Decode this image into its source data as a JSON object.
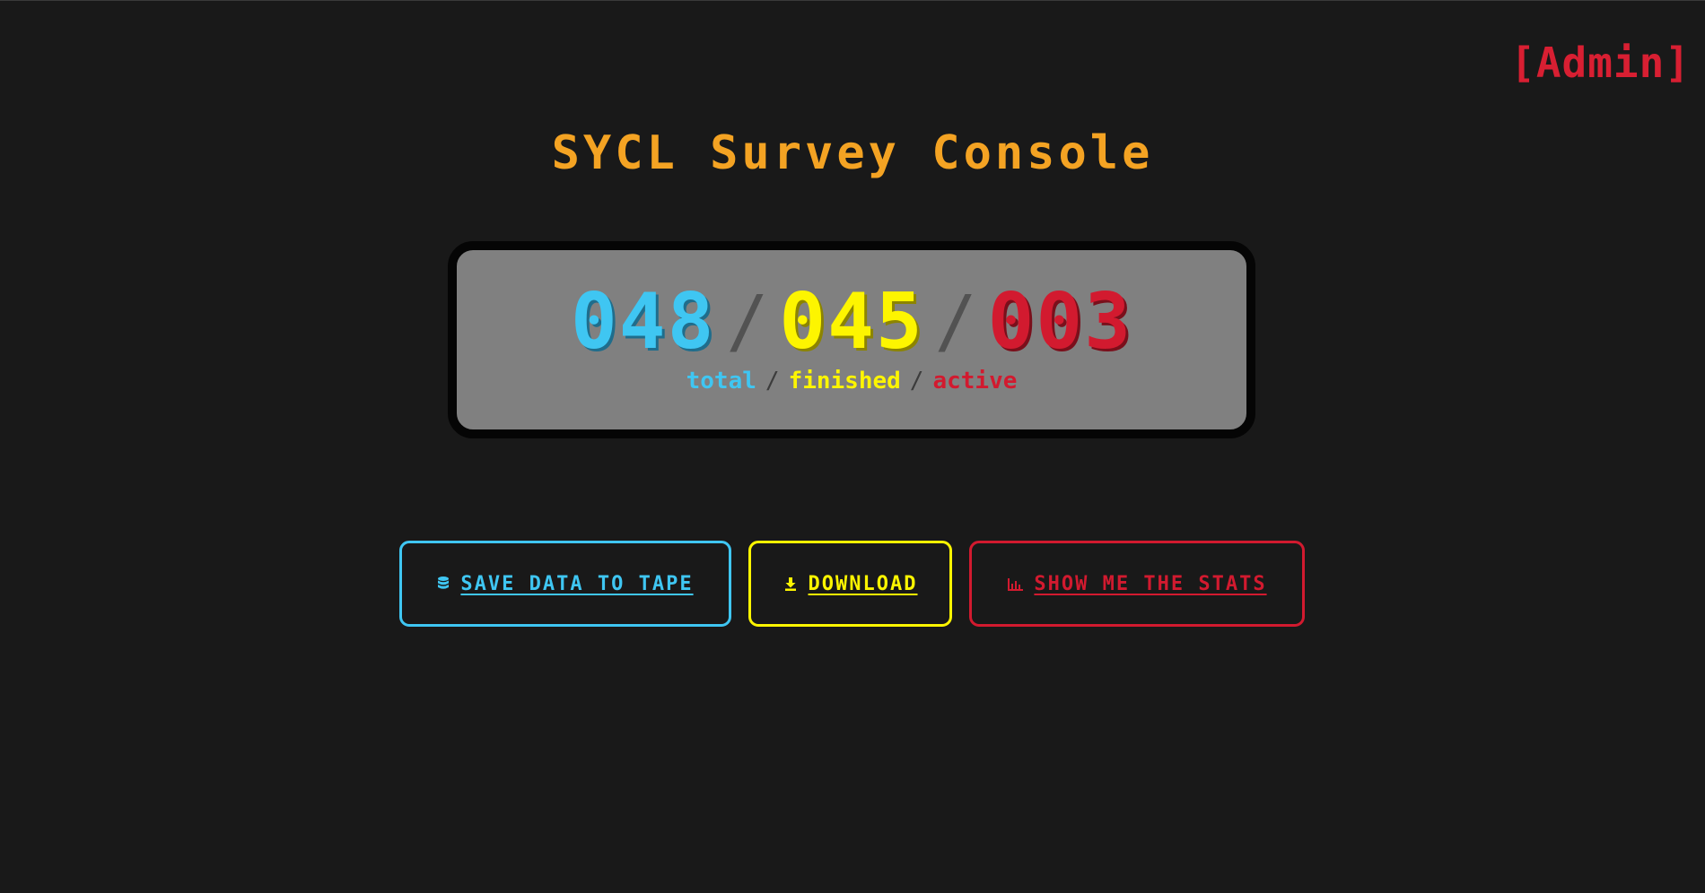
{
  "header": {
    "admin_link": "[Admin]"
  },
  "page_title": "SYCL Survey Console",
  "counters": {
    "total": "048",
    "finished": "045",
    "active": "003",
    "separator": "/",
    "labels": {
      "total": "total",
      "finished": "finished",
      "active": "active",
      "separator": "/"
    }
  },
  "actions": {
    "save": {
      "label": "SAVE DATA TO TAPE",
      "icon": "database-icon"
    },
    "download": {
      "label": "DOWNLOAD",
      "icon": "download-icon"
    },
    "stats": {
      "label": "SHOW ME THE STATS",
      "icon": "bar-chart-icon"
    }
  },
  "colors": {
    "background": "#191919",
    "title": "#f4a323",
    "admin": "#d81f32",
    "total": "#3fc6f2",
    "finished": "#fdf500",
    "active": "#d21a2f",
    "panel": "#808080",
    "panel_border": "#050505"
  }
}
